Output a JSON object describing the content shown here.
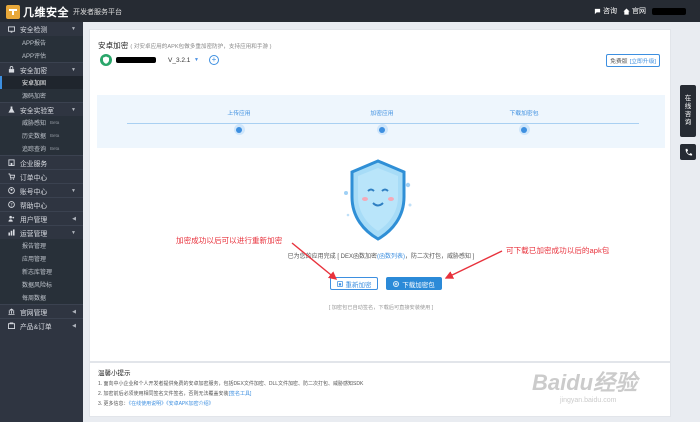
{
  "topbar": {
    "brand_name": "几维安全",
    "brand_sub": "开发者服务平台",
    "consult_label": "咨询",
    "home_label": "官网"
  },
  "sidebar": {
    "groups": [
      {
        "label": "安全检测",
        "icon": "monitor-icon",
        "subs": [
          "APP报告",
          "APP评估"
        ]
      },
      {
        "label": "安全加密",
        "icon": "lock-icon",
        "subs": [
          "安卓加固",
          "源码加密"
        ],
        "active_sub": 0
      },
      {
        "label": "安全实验室",
        "icon": "lab-icon",
        "subs": [
          "威胁感知",
          "历史数据",
          "追踪查询"
        ],
        "sub_badges": [
          "Beta",
          "Beta",
          "Beta"
        ]
      },
      {
        "label": "企业服务",
        "icon": "enterprise-icon"
      },
      {
        "label": "订单中心",
        "icon": "cart-icon"
      },
      {
        "label": "账号中心",
        "icon": "account-icon"
      },
      {
        "label": "帮助中心",
        "icon": "help-icon"
      },
      {
        "label": "用户管理",
        "icon": "users-icon"
      },
      {
        "label": "运营管理",
        "icon": "ops-icon",
        "subs": [
          "报告管理",
          "应用管理",
          "新志库管理",
          "数据风险标",
          "每周数据"
        ]
      },
      {
        "label": "官网管理",
        "icon": "site-icon"
      },
      {
        "label": "产品&订单",
        "icon": "product-icon"
      }
    ]
  },
  "main": {
    "title": "安卓加密",
    "title_hint": "( 对安卓应用的APK包做多重加密防护，支持应用和手游 )",
    "version": "V_3.2.1",
    "edition_label": "免费版",
    "upgrade_label": "[立即升级]",
    "steps": [
      "上传应用",
      "加密应用",
      "下载加密包"
    ],
    "status_prefix": "已为您的应用完成 [ DEX函数加密",
    "status_link": "(函数列表)",
    "status_suffix": "，防二次打包，威胁感知 ]",
    "reencrypt_label": "重新加密",
    "download_label": "下载加密包",
    "expire_note": "[ 加密包已自动签名，下载后可直接安装使用 ]"
  },
  "annotations": {
    "left": "加密成功以后可以进行重新加密",
    "right": "可下载已加密成功以后的apk包"
  },
  "tips": {
    "title": "温馨小提示",
    "line1": "1. 面向中小企业和个人开发者提供免费的安卓加密服务，包括DEX文件加密、DLL文件加密、防二次打包、威胁感知SDK",
    "line2_prefix": "2. 加密前后必须使用相同签名文件签名，否则无法覆盖安装",
    "line2_link": "[签名工具]",
    "line3_prefix": "3. 更多信息：",
    "line3_link1": "《在线使用说明》",
    "line3_link2": "《安卓APK加密介绍》"
  },
  "float": {
    "consult_chars": [
      "在",
      "线",
      "咨",
      "询"
    ]
  },
  "watermark": {
    "big": "Baidu经验",
    "small": "jingyan.baidu.com"
  },
  "colors": {
    "accent": "#3d8fe0",
    "annotation": "#e8323c",
    "sidebar_bg": "#2f3541",
    "topbar_bg": "#262b33"
  }
}
